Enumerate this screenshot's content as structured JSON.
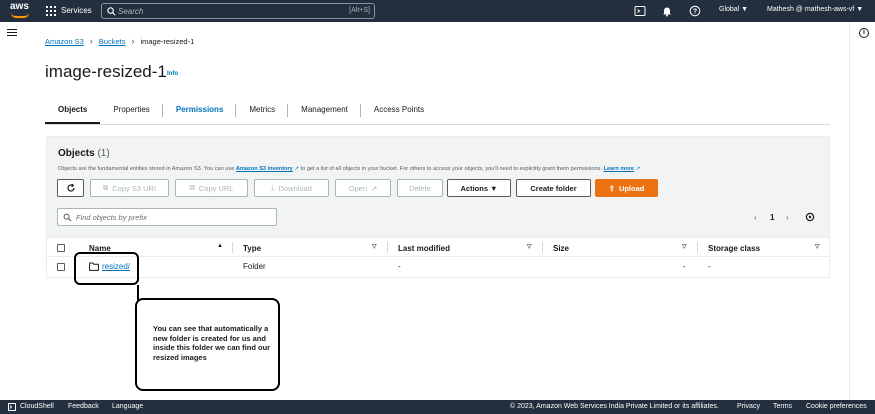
{
  "topbar": {
    "logo": "aws",
    "services_label": "Services",
    "search_placeholder": "Search",
    "search_shortcut": "[Alt+S]",
    "region_label": "Global ▼",
    "user_label": "Mathesh @ mathesh-aws-vf ▼",
    "icons": [
      "cloudshell-icon",
      "bell-icon",
      "help-icon",
      "settings-icon"
    ]
  },
  "breadcrumb": {
    "items": [
      "Amazon S3",
      "Buckets",
      "image-resized-1"
    ]
  },
  "page": {
    "title": "image-resized-1",
    "info_label": "Info"
  },
  "tabs": [
    {
      "label": "Objects",
      "active": true
    },
    {
      "label": "Properties",
      "active": false
    },
    {
      "label": "Permissions",
      "active": false
    },
    {
      "label": "Metrics",
      "active": false
    },
    {
      "label": "Management",
      "active": false
    },
    {
      "label": "Access Points",
      "active": false
    }
  ],
  "objects_panel": {
    "title": "Objects",
    "count": "(1)",
    "description_pre": "Objects are the fundamental entities stored in Amazon S3. You can use",
    "description_link": "Amazon S3 inventory",
    "description_mid": "to get a list of all objects in your bucket. For others to access your objects, you'll need to explicitly grant them permissions.",
    "learn_more": "Learn more",
    "buttons": {
      "copy_uri": "Copy S3 URI",
      "copy_url": "Copy URL",
      "download": "Download",
      "open": "Open",
      "delete": "Delete",
      "actions": "Actions ▼",
      "create_folder": "Create folder",
      "upload": "Upload"
    },
    "filter_placeholder": "Find objects by prefix",
    "page_number": "1",
    "columns": [
      "Name",
      "Type",
      "Last modified",
      "Size",
      "Storage class"
    ],
    "rows": [
      {
        "name": "resized/",
        "type": "Folder",
        "last_modified": "-",
        "size": "-",
        "storage_class": "-"
      }
    ]
  },
  "annotation": {
    "text": "You can see that automatically a new folder is created for us and inside this folder we can find our resized images"
  },
  "footer": {
    "cloudshell": "CloudShell",
    "feedback": "Feedback",
    "language": "Language",
    "copyright": "© 2023, Amazon Web Services India Private Limited or its affiliates.",
    "privacy": "Privacy",
    "terms": "Terms",
    "cookies": "Cookie preferences"
  },
  "colors": {
    "nav_bg": "#232f3e",
    "link": "#0073bb",
    "primary": "#ec7211",
    "logo_accent": "#ff9900"
  }
}
